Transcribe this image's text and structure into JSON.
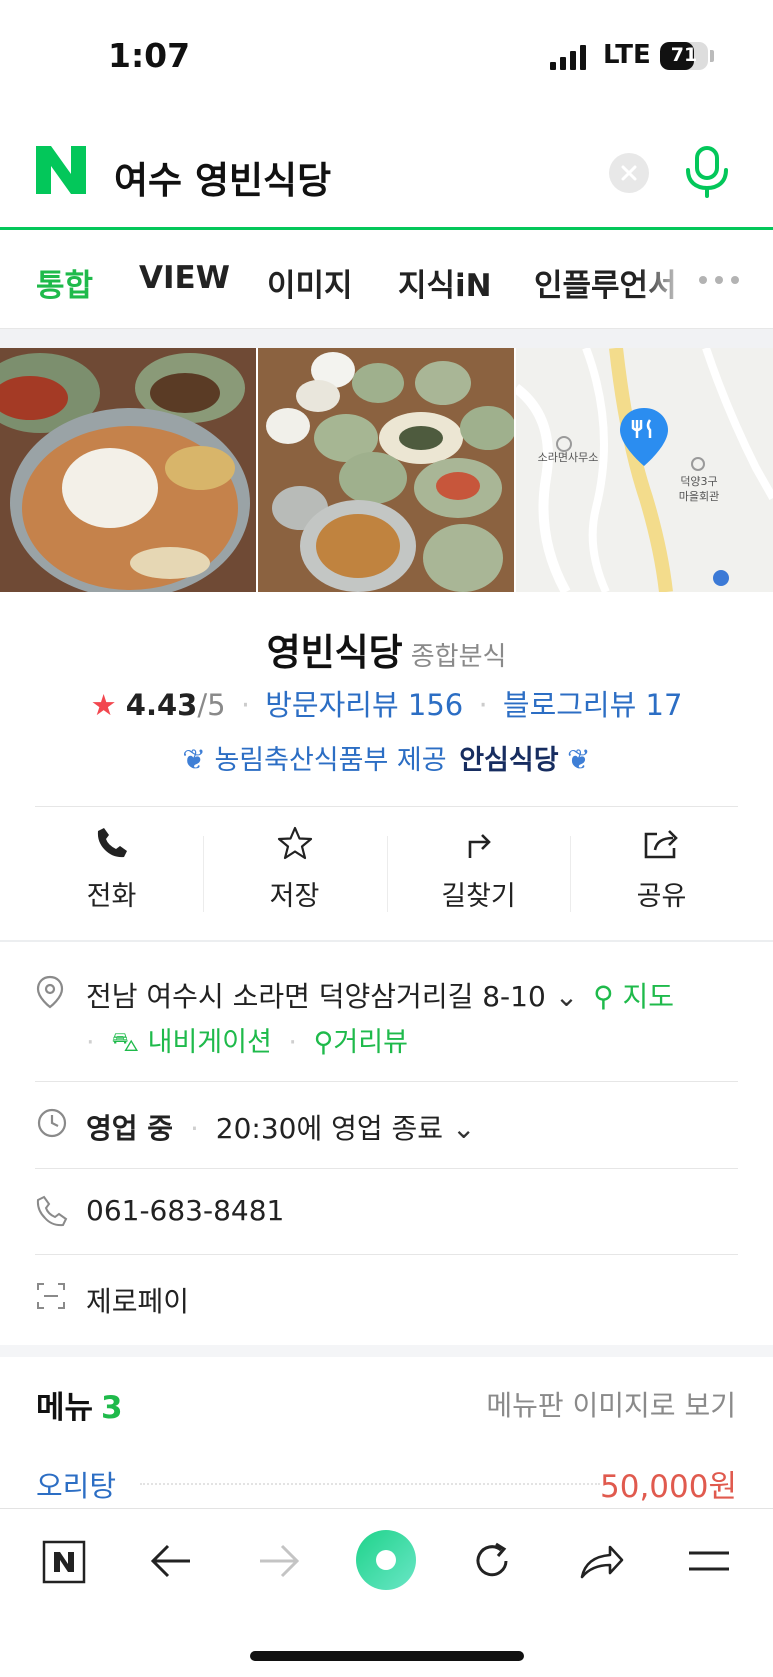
{
  "status_bar": {
    "time": "1:07",
    "network": "LTE",
    "battery": "71",
    "battery_level": 0.71
  },
  "search": {
    "query": "여수 영빈식당"
  },
  "tabs": [
    {
      "label": "통합",
      "active": true
    },
    {
      "label": "VIEW",
      "active": false
    },
    {
      "label": "이미지",
      "active": false
    },
    {
      "label": "지식iN",
      "active": false
    },
    {
      "label": "인플루언서",
      "active": false
    }
  ],
  "map": {
    "label_office": "소라면사무소",
    "label_hall_1": "덕양3구",
    "label_hall_2": "마을회관"
  },
  "place": {
    "name": "영빈식당",
    "category": "종합분식",
    "rating": "4.43",
    "rating_max": "/5",
    "visitor_reviews": "방문자리뷰 156",
    "blog_reviews": "블로그리뷰 17",
    "certification": "농림축산식품부 제공",
    "certification_brand": "안심식당"
  },
  "actions": [
    {
      "label": "전화",
      "icon": "phone-icon"
    },
    {
      "label": "저장",
      "icon": "star-icon"
    },
    {
      "label": "길찾기",
      "icon": "directions-icon"
    },
    {
      "label": "공유",
      "icon": "share-icon"
    }
  ],
  "info": {
    "address": "전남 여수시 소라면 덕양삼거리길 8-10",
    "map_link": "지도",
    "navigation_link": "내비게이션",
    "streetview_link": "거리뷰",
    "status": "영업 중",
    "hours": "20:30에 영업 종료",
    "phone": "061-683-8481",
    "payment": "제로페이"
  },
  "menu": {
    "title": "메뉴",
    "count": "3",
    "image_link": "메뉴판 이미지로 보기",
    "items": [
      {
        "name": "오리탕",
        "price": "50,000원"
      }
    ]
  },
  "colors": {
    "naver_green": "#03c75a",
    "link_blue": "#2c6ec4",
    "price_red": "#e05a4e",
    "star_red": "#f2474f"
  }
}
